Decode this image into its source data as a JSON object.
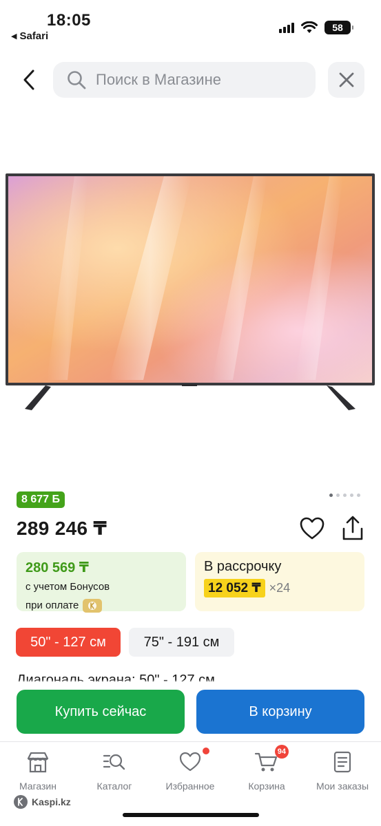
{
  "status_bar": {
    "time": "18:05",
    "back_app": "Safari",
    "battery": "58"
  },
  "search": {
    "placeholder": "Поиск в Магазине"
  },
  "product": {
    "bonus": "8 677 Б",
    "price": "289 246 ₸",
    "gallery_total": 5,
    "gallery_active": 0
  },
  "offers": {
    "bonus_price": "280 569 ₸",
    "bonus_line1": "с учетом Бонусов",
    "bonus_line2": "при оплате",
    "installment_title": "В рассрочку",
    "installment_monthly": "12 052 ₸",
    "installment_months": "×24"
  },
  "sizes": [
    {
      "label": "50\" - 127 см",
      "selected": true
    },
    {
      "label": "75\" - 191 см",
      "selected": false
    }
  ],
  "spec_line": "Диагональ экрана: 50\" - 127 см",
  "actions": {
    "buy_now": "Купить сейчас",
    "to_cart": "В корзину"
  },
  "tabs": [
    {
      "label": "Магазин",
      "icon": "store-icon"
    },
    {
      "label": "Каталог",
      "icon": "catalog-search-icon"
    },
    {
      "label": "Избранное",
      "icon": "heart-icon"
    },
    {
      "label": "Корзина",
      "icon": "cart-icon",
      "badge": "94"
    },
    {
      "label": "Мои заказы",
      "icon": "orders-icon"
    }
  ],
  "footer": {
    "brand": "Kaspi.kz"
  },
  "colors": {
    "bonus_green": "#44a31a",
    "buy_green": "#19a84a",
    "cart_blue": "#1b74d1",
    "chip_red": "#f14635",
    "installment_yellow": "#f7d21b"
  }
}
